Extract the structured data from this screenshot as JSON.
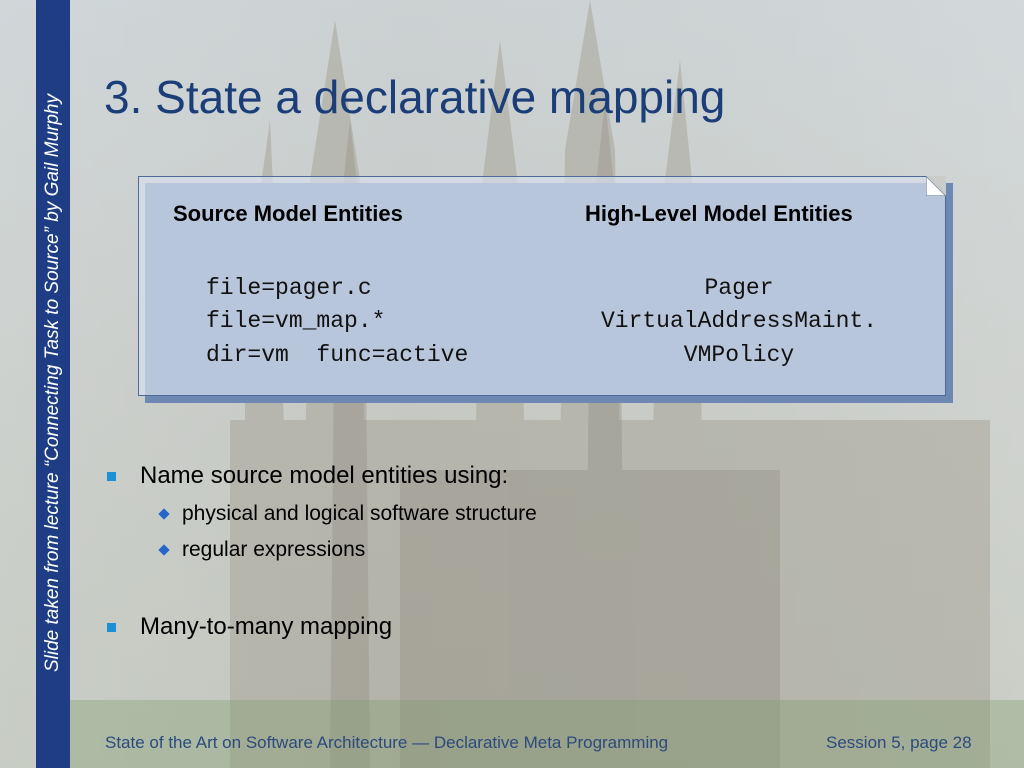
{
  "side": {
    "credit": "Slide taken from lecture “Connecting Task to Source” by Gail Murphy"
  },
  "slide": {
    "title": "3. State a declarative mapping"
  },
  "mapping": {
    "headers": [
      "Source Model Entities",
      "High-Level Model Entities"
    ],
    "rows": [
      {
        "source": "file=pager.c",
        "target": "Pager"
      },
      {
        "source": "file=vm_map.*",
        "target": "VirtualAddressMaint."
      },
      {
        "source": "dir=vm  func=active",
        "target": "VMPolicy"
      }
    ]
  },
  "bullets": [
    {
      "text": "Name source model entities using:",
      "sub": [
        "physical and logical software structure",
        "regular expressions"
      ]
    },
    {
      "text": "Many-to-many mapping"
    }
  ],
  "footer": {
    "left": "State of the Art on Software Architecture — Declarative Meta Programming",
    "right": "Session 5, page 28"
  },
  "colors": {
    "band": "#1f3d85",
    "title": "#1b3e78",
    "bullet": "#1d8fd6",
    "footer": "#2c4a7d"
  }
}
